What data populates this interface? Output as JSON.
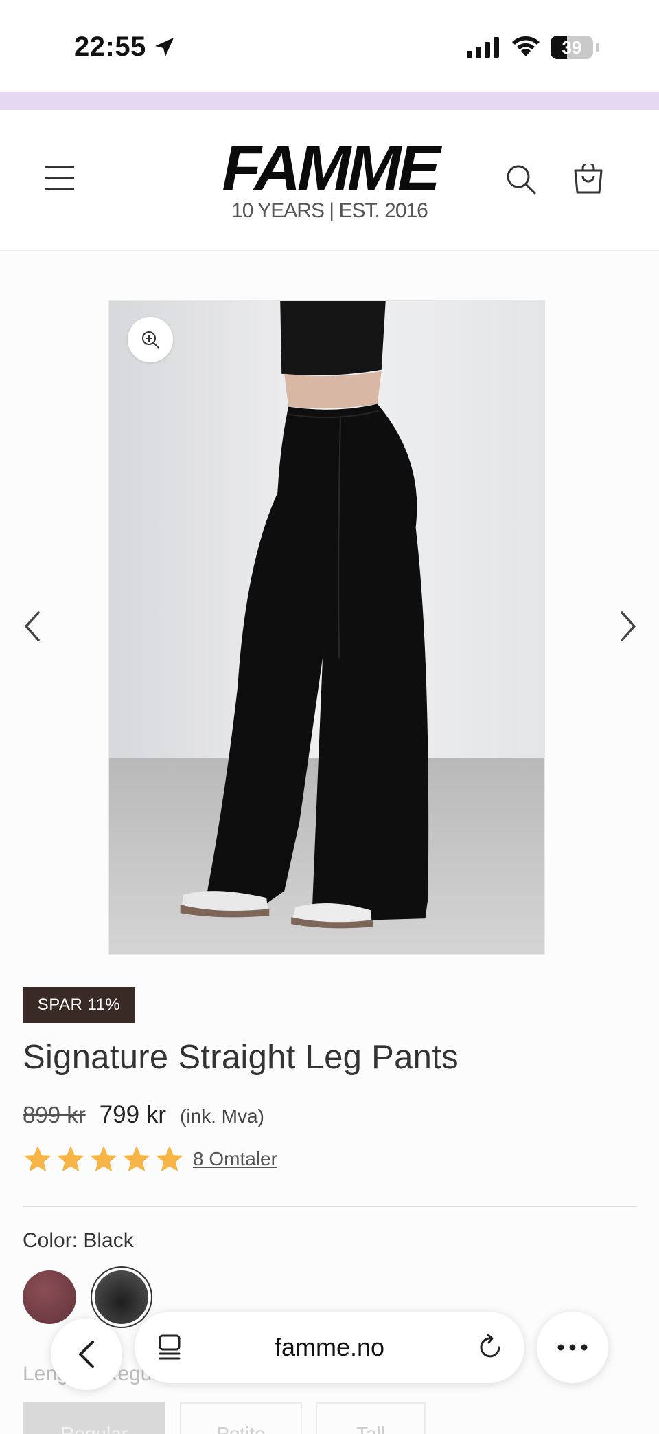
{
  "status_bar": {
    "time": "22:55",
    "battery": "39",
    "battery_level": 0.39
  },
  "header": {
    "logo_text": "FAMME",
    "logo_tagline": "10 YEARS |  EST. 2016",
    "icons": [
      "menu-icon",
      "search-icon",
      "cart-icon"
    ]
  },
  "gallery": {
    "icons": [
      "zoom-icon",
      "chevron-left-icon",
      "chevron-right-icon"
    ]
  },
  "product": {
    "badge": "SPAR 11%",
    "title": "Signature Straight Leg Pants",
    "old_price": "899 kr",
    "price": "799 kr",
    "vat_note": "(ink. Mva)",
    "rating": 5,
    "reviews_link": "8 Omtaler"
  },
  "options": {
    "color_label": "Color: Black",
    "colors": [
      {
        "name": "burgundy",
        "hex": "#7a444b",
        "selected": false
      },
      {
        "name": "black",
        "hex": "#2f2f2f",
        "selected": true
      }
    ],
    "length_label": "Lengde: Regular",
    "lengths": [
      "Regular",
      "Petite",
      "Tall"
    ]
  },
  "browser": {
    "url": "famme.no"
  },
  "colors": {
    "badge": "#3a2a26",
    "star": "#f6b545",
    "promo_bar": "#e6d8f2"
  }
}
